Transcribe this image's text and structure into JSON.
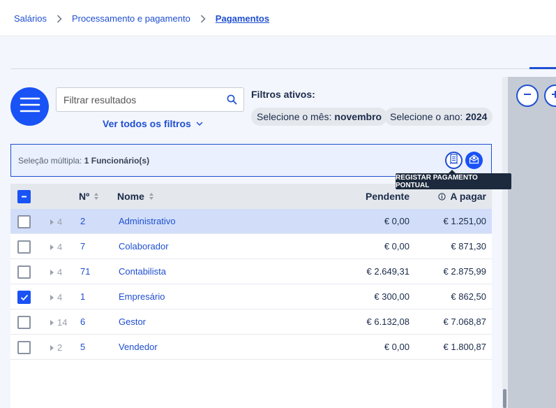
{
  "breadcrumb": {
    "items": [
      "Salários",
      "Processamento e pagamento",
      "Pagamentos"
    ]
  },
  "filter": {
    "placeholder": "Filtrar resultados",
    "ver_todos": "Ver todos os filtros",
    "ativos_title": "Filtros ativos:",
    "chips": [
      {
        "label": "Selecione o mês:",
        "value": "novembro"
      },
      {
        "label": "Selecione o ano:",
        "value": "2024"
      }
    ]
  },
  "selection": {
    "label": "Seleção múltipla:",
    "value": "1 Funcionário(s)"
  },
  "tooltip": "REGISTAR PAGAMENTO PONTUAL",
  "table": {
    "headers": {
      "num": "Nº",
      "nome": "Nome",
      "pendente": "Pendente",
      "a_pagar": "A pagar"
    },
    "rows": [
      {
        "count": "4",
        "num": "2",
        "nome": "Administrativo",
        "pendente": "€ 0,00",
        "a_pagar": "€ 1.251,00",
        "checked": false,
        "highlight": true
      },
      {
        "count": "4",
        "num": "7",
        "nome": "Colaborador",
        "pendente": "€ 0,00",
        "a_pagar": "€ 871,30",
        "checked": false,
        "highlight": false
      },
      {
        "count": "4",
        "num": "71",
        "nome": "Contabilista",
        "pendente": "€ 2.649,31",
        "a_pagar": "€ 2.875,99",
        "checked": false,
        "highlight": false
      },
      {
        "count": "4",
        "num": "1",
        "nome": "Empresário",
        "pendente": "€ 300,00",
        "a_pagar": "€ 862,50",
        "checked": true,
        "highlight": false
      },
      {
        "count": "14",
        "num": "6",
        "nome": "Gestor",
        "pendente": "€ 6.132,08",
        "a_pagar": "€ 7.068,87",
        "checked": false,
        "highlight": false
      },
      {
        "count": "2",
        "num": "5",
        "nome": "Vendedor",
        "pendente": "€ 0,00",
        "a_pagar": "€ 1.800,87",
        "checked": false,
        "highlight": false
      }
    ]
  },
  "colors": {
    "accent": "#1952f5",
    "link": "#1f4fd1",
    "row_highlight": "#d2def9"
  },
  "icons": [
    "chevron-right-icon",
    "search-icon",
    "menu-icon",
    "chevron-down-icon",
    "receipt-icon",
    "payment-envelope-icon",
    "info-icon",
    "sort-icon",
    "zoom-out-icon",
    "zoom-in-icon"
  ]
}
